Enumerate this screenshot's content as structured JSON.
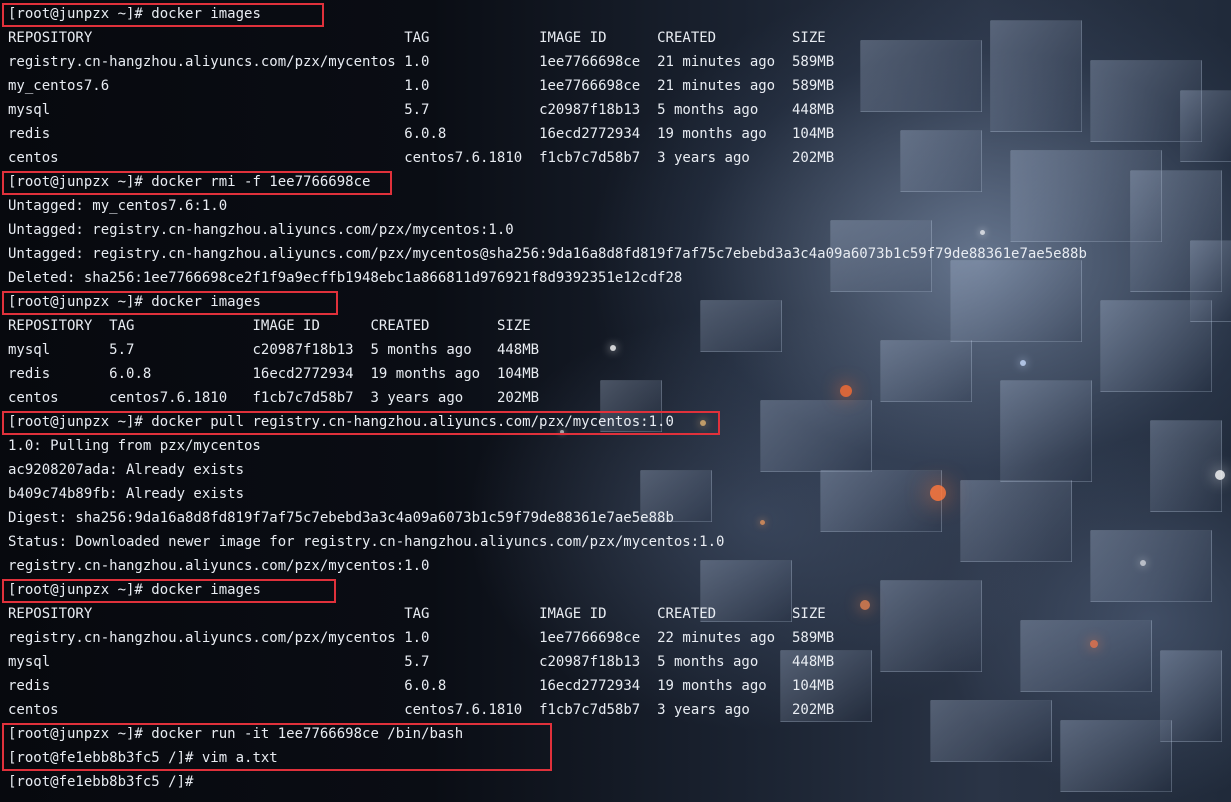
{
  "prompt": "[root@junpzx ~]#",
  "container_prompt": "[root@fe1ebb8b3fc5 /]#",
  "images_header": [
    "REPOSITORY",
    "TAG",
    "IMAGE ID",
    "CREATED",
    "SIZE"
  ],
  "block1": {
    "command": "docker images",
    "rows": [
      [
        "registry.cn-hangzhou.aliyuncs.com/pzx/mycentos",
        "1.0",
        "1ee7766698ce",
        "21 minutes ago",
        "589MB"
      ],
      [
        "my_centos7.6",
        "1.0",
        "1ee7766698ce",
        "21 minutes ago",
        "589MB"
      ],
      [
        "mysql",
        "5.7",
        "c20987f18b13",
        "5 months ago",
        "448MB"
      ],
      [
        "redis",
        "6.0.8",
        "16ecd2772934",
        "19 months ago",
        "104MB"
      ],
      [
        "centos",
        "centos7.6.1810",
        "f1cb7c7d58b7",
        "3 years ago",
        "202MB"
      ]
    ]
  },
  "block2": {
    "command": "docker rmi -f 1ee7766698ce",
    "output": [
      "Untagged: my_centos7.6:1.0",
      "Untagged: registry.cn-hangzhou.aliyuncs.com/pzx/mycentos:1.0",
      "Untagged: registry.cn-hangzhou.aliyuncs.com/pzx/mycentos@sha256:9da16a8d8fd819f7af75c7ebebd3a3c4a09a6073b1c59f79de88361e7ae5e88b",
      "Deleted: sha256:1ee7766698ce2f1f9a9ecffb1948ebc1a866811d976921f8d9392351e12cdf28"
    ]
  },
  "block3": {
    "command": "docker images",
    "rows": [
      [
        "mysql",
        "5.7",
        "c20987f18b13",
        "5 months ago",
        "448MB"
      ],
      [
        "redis",
        "6.0.8",
        "16ecd2772934",
        "19 months ago",
        "104MB"
      ],
      [
        "centos",
        "centos7.6.1810",
        "f1cb7c7d58b7",
        "3 years ago",
        "202MB"
      ]
    ]
  },
  "block4": {
    "command": "docker pull registry.cn-hangzhou.aliyuncs.com/pzx/mycentos:1.0",
    "output": [
      "1.0: Pulling from pzx/mycentos",
      "ac9208207ada: Already exists",
      "b409c74b89fb: Already exists",
      "Digest: sha256:9da16a8d8fd819f7af75c7ebebd3a3c4a09a6073b1c59f79de88361e7ae5e88b",
      "Status: Downloaded newer image for registry.cn-hangzhou.aliyuncs.com/pzx/mycentos:1.0",
      "registry.cn-hangzhou.aliyuncs.com/pzx/mycentos:1.0"
    ]
  },
  "block5": {
    "command": "docker images",
    "rows": [
      [
        "registry.cn-hangzhou.aliyuncs.com/pzx/mycentos",
        "1.0",
        "1ee7766698ce",
        "22 minutes ago",
        "589MB"
      ],
      [
        "mysql",
        "5.7",
        "c20987f18b13",
        "5 months ago",
        "448MB"
      ],
      [
        "redis",
        "6.0.8",
        "16ecd2772934",
        "19 months ago",
        "104MB"
      ],
      [
        "centos",
        "centos7.6.1810",
        "f1cb7c7d58b7",
        "3 years ago",
        "202MB"
      ]
    ]
  },
  "block6": {
    "command": "docker run -it 1ee7766698ce /bin/bash",
    "container_command": "vim a.txt"
  },
  "colors": {
    "highlight": "#e0313b",
    "text": "#e8ecf2"
  }
}
